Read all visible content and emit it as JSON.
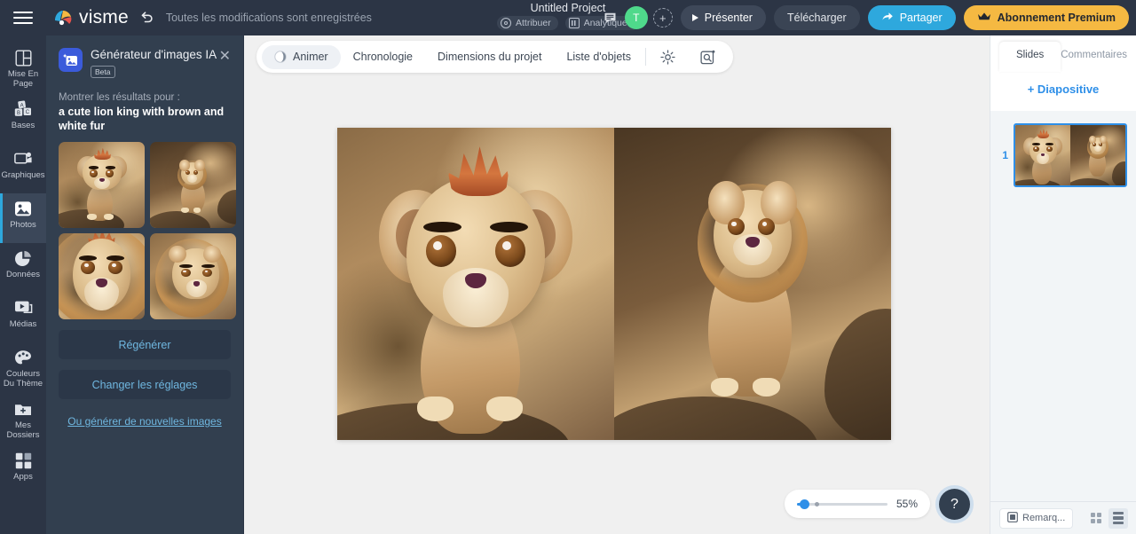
{
  "topbar": {
    "menu_icon": "hamburger-icon",
    "brand": "visme",
    "undo_icon": "undo-icon",
    "save_status": "Toutes les modifications sont enregistrées",
    "project_title": "Untitled Project",
    "meta_chips": [
      {
        "label": "Attribuer",
        "icon": "person-circle-icon"
      },
      {
        "label": "Analytiques",
        "icon": "analytics-icon"
      }
    ],
    "chat_icon": "comment-icon",
    "avatar_initial": "T",
    "add_user_icon": "plus-icon",
    "buttons": {
      "present": "Présenter",
      "download": "Télécharger",
      "share": "Partager",
      "premium": "Abonnement Premium"
    }
  },
  "rail": {
    "items": [
      {
        "label": "Mise En Page",
        "icon": "layout-icon",
        "active": false
      },
      {
        "label": "Bases",
        "icon": "blocks-icon",
        "active": false
      },
      {
        "label": "Graphiques",
        "icon": "graphics-icon",
        "active": false
      },
      {
        "label": "Photos",
        "icon": "photo-icon",
        "active": true
      },
      {
        "label": "Données",
        "icon": "pie-chart-icon",
        "active": false
      },
      {
        "label": "Médias",
        "icon": "media-icon",
        "active": false
      },
      {
        "label": "Couleurs Du Thème",
        "icon": "palette-icon",
        "active": false
      },
      {
        "label": "Mes Dossiers",
        "icon": "folder-plus-icon",
        "active": false
      },
      {
        "label": "Apps",
        "icon": "apps-grid-icon",
        "active": false
      }
    ]
  },
  "ai_panel": {
    "icon": "ai-image-icon",
    "title": "Générateur d'images IA",
    "badge": "Beta",
    "close_icon": "close-icon",
    "results_label": "Montrer les résultats pour :",
    "prompt": "a cute lion king with brown and white fur",
    "thumbnails": [
      {
        "name": "ai-result-1",
        "alt": "cute lion cub standing on rock"
      },
      {
        "name": "ai-result-2",
        "alt": "lion cub sitting on rock profile"
      },
      {
        "name": "ai-result-3",
        "alt": "lion face close-up with mane"
      },
      {
        "name": "ai-result-4",
        "alt": "young lion with mane looking left"
      }
    ],
    "regenerate_button": "Régénérer",
    "settings_button": "Changer les réglages",
    "new_images_link": "Ou générer de nouvelles images"
  },
  "toolbar": {
    "items": [
      {
        "label": "Animer",
        "icon": "animate-icon",
        "active": true
      },
      {
        "label": "Chronologie",
        "icon": "",
        "active": false
      },
      {
        "label": "Dimensions du projet",
        "icon": "",
        "active": false
      },
      {
        "label": "Liste d'objets",
        "icon": "",
        "active": false
      }
    ],
    "settings_icon": "gear-icon",
    "preview_icon": "magnifier-box-icon"
  },
  "canvas": {
    "left_image_alt": "cute lion cub facing camera on rock",
    "right_image_alt": "lion cub seated on rock in profile"
  },
  "zoom_control": {
    "value": "55%",
    "percent": 55
  },
  "help_button": {
    "label": "?"
  },
  "right_panel": {
    "tabs": [
      {
        "label": "Slides",
        "active": true
      },
      {
        "label": "Commentaires",
        "active": false
      }
    ],
    "add_slide": "+ Diapositive",
    "slides": [
      {
        "number": "1",
        "alt": "slide 1 with two lion images"
      }
    ],
    "notes_button": {
      "label": "Remarq...",
      "icon": "note-icon"
    },
    "layout_buttons": [
      {
        "name": "grid-view-button",
        "icon": "grid-icon",
        "active": false
      },
      {
        "name": "list-view-button",
        "icon": "rows-icon",
        "active": true
      }
    ]
  },
  "colors": {
    "topbar_bg": "#2c3545",
    "panel_bg": "#323f4f",
    "accent_blue": "#2ea8dd",
    "premium_yellow": "#f5b942",
    "link_blue": "#6fb7e0",
    "avatar_green": "#4fd98b",
    "workspace_bg": "#f0f0f0",
    "right_panel_bg": "#f2f5f7"
  }
}
